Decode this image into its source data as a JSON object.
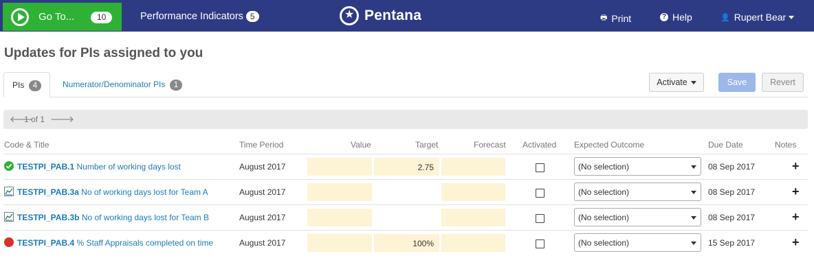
{
  "nav": {
    "goto_label": "Go To...",
    "goto_count": "10",
    "pi_label": "Performance Indicators",
    "pi_count": "5",
    "brand": "Pentana",
    "print": "Print",
    "help": "Help",
    "user": "Rupert Bear"
  },
  "page_title": "Updates for PIs assigned to you",
  "tabs": [
    {
      "label": "PIs",
      "count": "4"
    },
    {
      "label": "Numerator/Denominator PIs",
      "count": "1"
    }
  ],
  "buttons": {
    "activate": "Activate",
    "save": "Save",
    "revert": "Revert"
  },
  "pager": {
    "text": "1 of 1"
  },
  "columns": {
    "code_title": "Code & Title",
    "time_period": "Time Period",
    "value": "Value",
    "target": "Target",
    "forecast": "Forecast",
    "activated": "Activated",
    "expected_outcome": "Expected Outcome",
    "due_date": "Due Date",
    "notes": "Notes"
  },
  "rows": [
    {
      "code": "TESTPI_PAB.1",
      "title": "Number of working days lost",
      "status_icon": "check-circle-icon",
      "time_period": "August 2017",
      "value": "",
      "target": "2.75",
      "forecast": "",
      "outcome": "(No selection)",
      "due": "08 Sep 2017"
    },
    {
      "code": "TESTPI_PAB.3a",
      "title": "No of working days lost for Team A",
      "status_icon": "chart-icon",
      "time_period": "August 2017",
      "value": "",
      "target": "",
      "forecast": "",
      "outcome": "(No selection)",
      "due": "08 Sep 2017"
    },
    {
      "code": "TESTPI_PAB.3b",
      "title": "No of working days lost for Team B",
      "status_icon": "chart-icon",
      "time_period": "August 2017",
      "value": "",
      "target": "",
      "forecast": "",
      "outcome": "(No selection)",
      "due": "08 Sep 2017"
    },
    {
      "code": "TESTPI_PAB.4",
      "title": "% Staff Appraisals completed on time",
      "status_icon": "stop-circle-icon",
      "time_period": "August 2017",
      "value": "",
      "target": "100%",
      "forecast": "",
      "outcome": "(No selection)",
      "due": "15 Sep 2017"
    }
  ],
  "colors": {
    "nav_bg": "#2d3b85",
    "goto_bg": "#2eb135",
    "link": "#1a7bb9",
    "input_bg": "#fdf4d6",
    "ok": "#2eb135",
    "alert": "#d9312b"
  }
}
